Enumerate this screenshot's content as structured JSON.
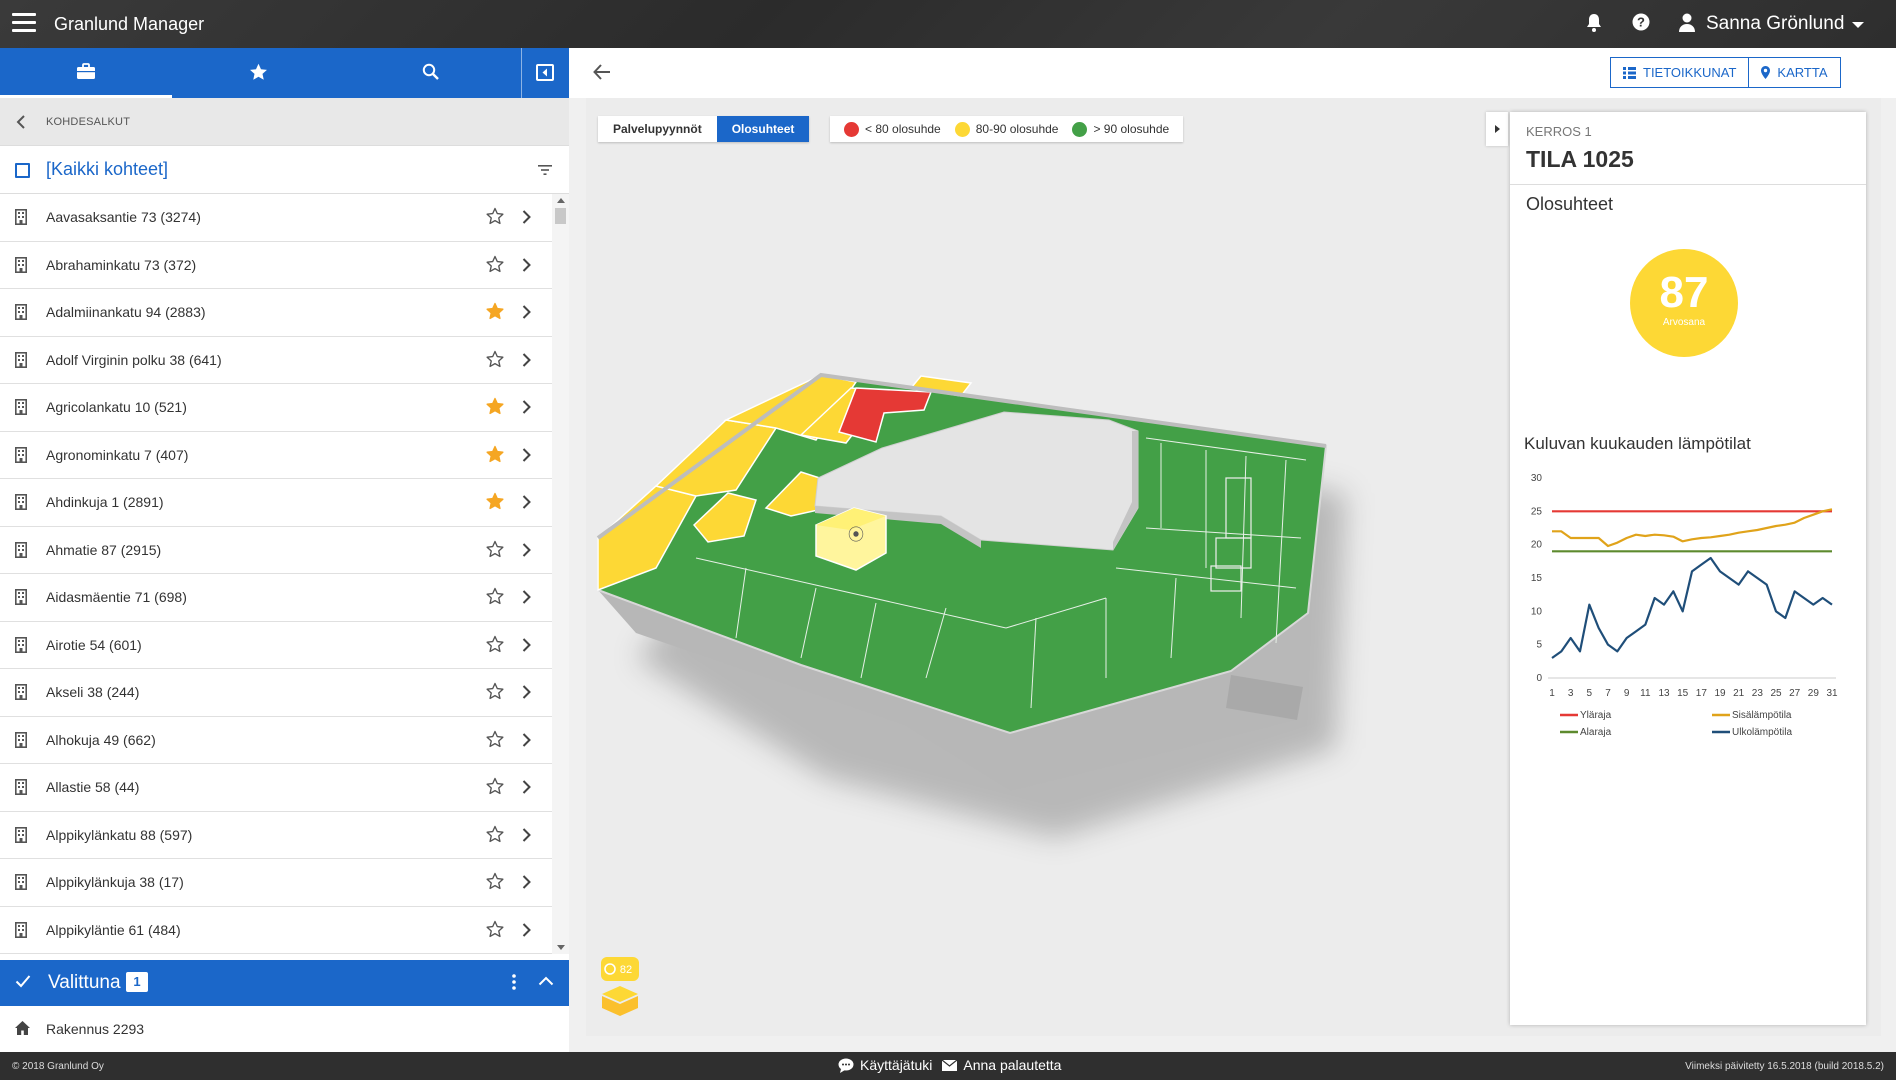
{
  "app": {
    "title": "Granlund Manager",
    "user_name": "Sanna Grönlund"
  },
  "sidebar": {
    "tabs": [
      {
        "name": "briefcase-icon"
      },
      {
        "name": "star-icon"
      },
      {
        "name": "search-icon"
      }
    ],
    "section_label": "KOHDESALKUT",
    "all_label": "[Kaikki kohteet]",
    "items": [
      {
        "label": "Aavasaksantie 73 (3274)",
        "favorite": false
      },
      {
        "label": "Abrahaminkatu 73 (372)",
        "favorite": false
      },
      {
        "label": "Adalmiinankatu 94 (2883)",
        "favorite": true
      },
      {
        "label": "Adolf Virginin polku 38 (641)",
        "favorite": false
      },
      {
        "label": "Agricolankatu 10 (521)",
        "favorite": true
      },
      {
        "label": "Agronominkatu 7 (407)",
        "favorite": true
      },
      {
        "label": "Ahdinkuja 1 (2891)",
        "favorite": true
      },
      {
        "label": "Ahmatie 87 (2915)",
        "favorite": false
      },
      {
        "label": "Aidasmäentie 71 (698)",
        "favorite": false
      },
      {
        "label": "Airotie 54 (601)",
        "favorite": false
      },
      {
        "label": "Akseli 38 (244)",
        "favorite": false
      },
      {
        "label": "Alhokuja 49 (662)",
        "favorite": false
      },
      {
        "label": "Allastie 58 (44)",
        "favorite": false
      },
      {
        "label": "Alppikylänkatu 88 (597)",
        "favorite": false
      },
      {
        "label": "Alppikylänkuja 38 (17)",
        "favorite": false
      },
      {
        "label": "Alppikyläntie 61 (484)",
        "favorite": false
      }
    ],
    "selected_label": "Valittuna",
    "selected_count": "1",
    "building_label": "Rakennus 2293"
  },
  "toolbar": {
    "info_windows_label": "TIETOIKKUNAT",
    "map_label": "KARTTA"
  },
  "viewer": {
    "toggle_service": "Palvelupyynnöt",
    "toggle_conditions": "Olosuhteet",
    "legend": [
      {
        "label": "< 80 olosuhde",
        "color": "#e53935"
      },
      {
        "label": "80-90 olosuhde",
        "color": "#fdd835"
      },
      {
        "label": "> 90 olosuhde",
        "color": "#43a047"
      }
    ],
    "badge_value": "82"
  },
  "info_panel": {
    "floor": "KERROS 1",
    "room": "TILA 1025",
    "conditions_label": "Olosuhteet",
    "score": "87",
    "score_label": "Arvosana",
    "chart_title": "Kuluvan kuukauden lämpötilat"
  },
  "chart_data": {
    "type": "line",
    "title": "Kuluvan kuukauden lämpötilat",
    "x": [
      1,
      2,
      3,
      4,
      5,
      6,
      7,
      8,
      9,
      10,
      11,
      12,
      13,
      14,
      15,
      16,
      17,
      18,
      19,
      20,
      21,
      22,
      23,
      24,
      25,
      26,
      27,
      28,
      29,
      30,
      31
    ],
    "x_tick_labels": [
      "1",
      "3",
      "5",
      "7",
      "9",
      "11",
      "13",
      "15",
      "17",
      "19",
      "21",
      "23",
      "25",
      "27",
      "29",
      "31"
    ],
    "y_ticks": [
      0,
      5,
      10,
      15,
      20,
      25,
      30
    ],
    "ylim": [
      0,
      30
    ],
    "series": [
      {
        "name": "Yläraja",
        "color": "#e53935",
        "values": [
          25,
          25,
          25,
          25,
          25,
          25,
          25,
          25,
          25,
          25,
          25,
          25,
          25,
          25,
          25,
          25,
          25,
          25,
          25,
          25,
          25,
          25,
          25,
          25,
          25,
          25,
          25,
          25,
          25,
          25,
          25
        ]
      },
      {
        "name": "Sisälämpötila",
        "color": "#e0a31a",
        "values": [
          22,
          22,
          21,
          21,
          21,
          21,
          19.8,
          20.3,
          21,
          21.5,
          21.3,
          21.5,
          21.4,
          21.2,
          20.5,
          20.8,
          21,
          21.1,
          21.3,
          21.5,
          21.8,
          22,
          22.2,
          22.5,
          22.8,
          23,
          23.3,
          24,
          24.5,
          25,
          25.3
        ]
      },
      {
        "name": "Alaraja",
        "color": "#5d8a2e",
        "values": [
          19,
          19,
          19,
          19,
          19,
          19,
          19,
          19,
          19,
          19,
          19,
          19,
          19,
          19,
          19,
          19,
          19,
          19,
          19,
          19,
          19,
          19,
          19,
          19,
          19,
          19,
          19,
          19,
          19,
          19,
          19
        ]
      },
      {
        "name": "Ulkolämpötila",
        "color": "#1f4e79",
        "values": [
          3,
          4,
          6,
          4,
          11,
          7.5,
          5,
          4,
          6,
          7,
          8,
          12,
          11,
          13,
          10,
          16,
          17,
          18,
          16,
          15,
          14,
          16,
          15,
          14,
          10,
          9,
          13,
          12,
          11,
          12,
          11
        ]
      }
    ],
    "legend": [
      "Yläraja",
      "Sisälämpötila",
      "Alaraja",
      "Ulkolämpötila"
    ],
    "legend_placement": "bottom"
  },
  "footer": {
    "copyright": "© 2018 Granlund Oy",
    "user_guide": "Käyttäjätuki",
    "feedback": "Anna palautetta",
    "updated": "Viimeksi päivitetty 16.5.2018 (build 2018.5.2)"
  }
}
